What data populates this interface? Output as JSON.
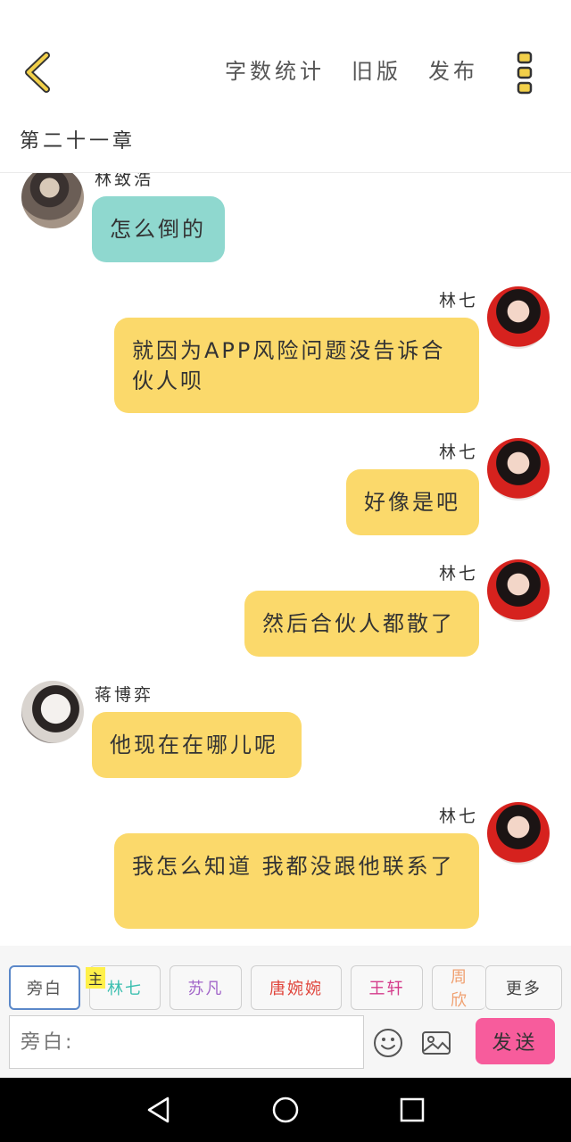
{
  "header": {
    "actions": [
      "字数统计",
      "旧版",
      "发布"
    ],
    "chapter_title": "第二十一章"
  },
  "messages": [
    {
      "side": "left",
      "name": "林致浩",
      "text": "怎么倒的",
      "bubble_color": "#8fd8cf"
    },
    {
      "side": "right",
      "name": "林七",
      "text": "就因为APP风险问题没告诉合伙人呗",
      "bubble_color": "#fbd96b"
    },
    {
      "side": "right",
      "name": "林七",
      "text": "好像是吧",
      "bubble_color": "#fbd96b"
    },
    {
      "side": "right",
      "name": "林七",
      "text": "然后合伙人都散了",
      "bubble_color": "#fbd96b"
    },
    {
      "side": "left",
      "name": "蒋博弈",
      "text": "他现在在哪儿呢",
      "bubble_color": "#fbd96b"
    },
    {
      "side": "right",
      "name": "林七",
      "text": "我怎么知道 我都没跟他联系了",
      "bubble_color": "#fbd96b"
    }
  ],
  "roles": [
    {
      "label": "旁白",
      "color": "#555555",
      "active": true
    },
    {
      "label": "林七",
      "color": "#3bbfb0",
      "active": false
    },
    {
      "label": "苏凡",
      "color": "#a266c9",
      "active": false
    },
    {
      "label": "唐婉婉",
      "color": "#e0453b",
      "active": false
    },
    {
      "label": "王轩",
      "color": "#d43a8a",
      "active": false
    },
    {
      "label": "周欣",
      "color": "#f0a070",
      "active": false
    },
    {
      "label": "更多",
      "color": "#444444",
      "active": false
    }
  ],
  "main_badge": "主",
  "input": {
    "placeholder": "旁白:"
  },
  "send_label": "发送",
  "colors": {
    "accent_yellow": "#f2c94c",
    "send_pink": "#f75c9c",
    "active_role_border": "#5b88c9"
  },
  "icons": [
    "back-arrow-icon",
    "more-icon",
    "emoji-icon",
    "image-icon",
    "nav-back-icon",
    "nav-home-icon",
    "nav-recents-icon"
  ]
}
